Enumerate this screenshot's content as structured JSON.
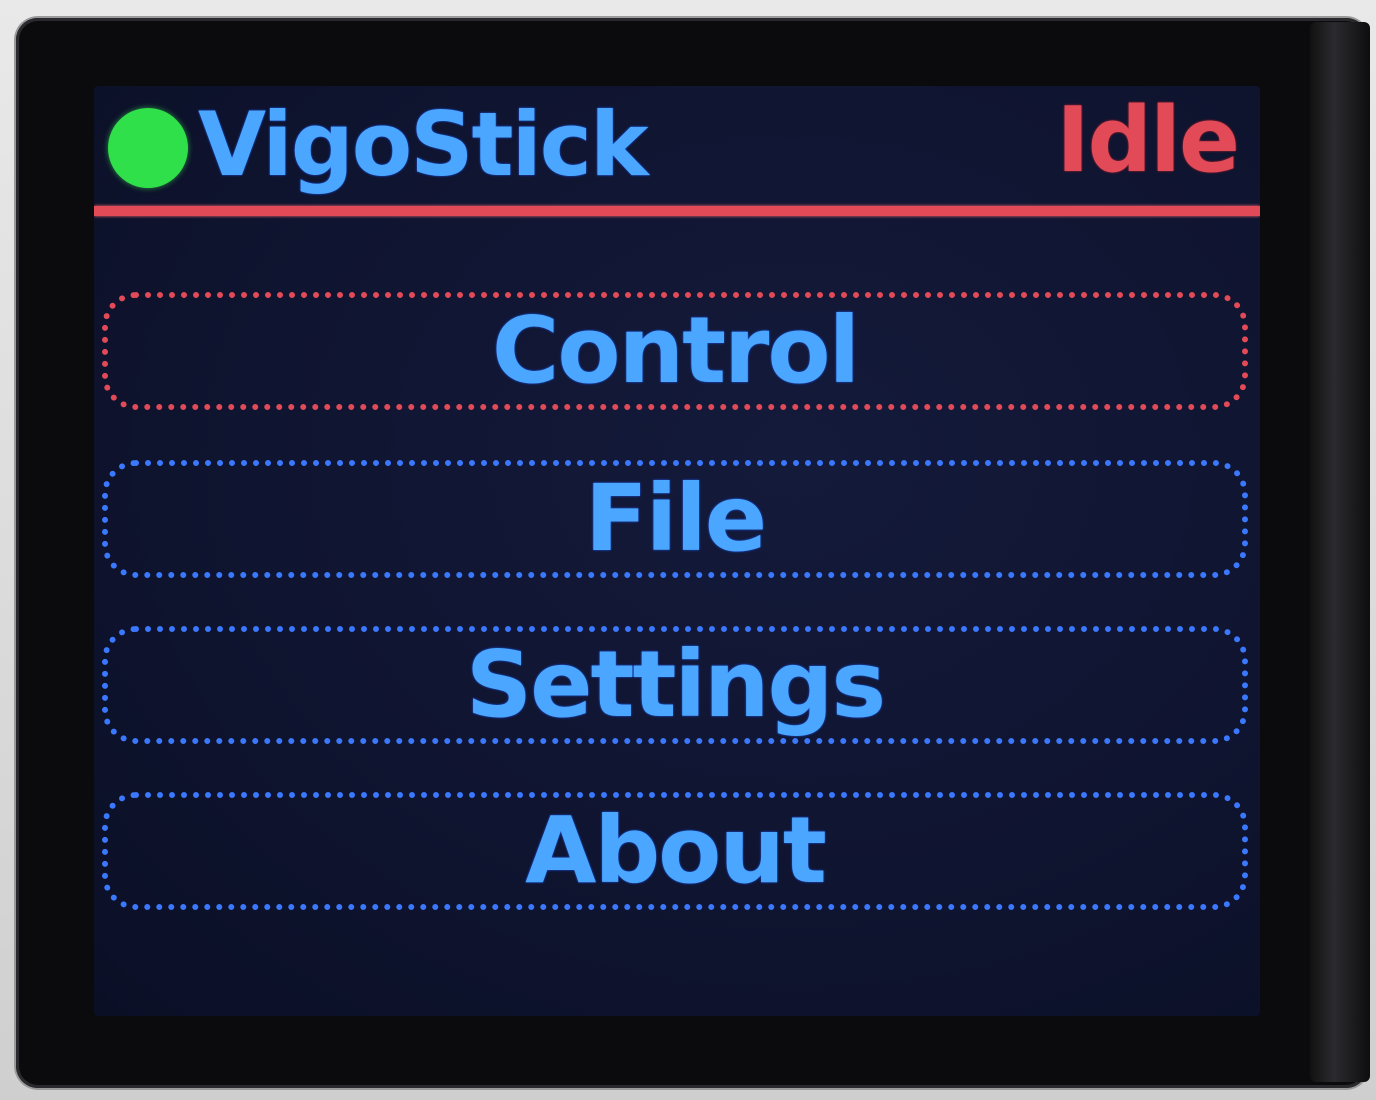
{
  "header": {
    "status_indicator": "green-dot-icon",
    "title": "VigoStick",
    "state": "Idle"
  },
  "menu": {
    "selected_index": 0,
    "items": [
      {
        "label": "Control"
      },
      {
        "label": "File"
      },
      {
        "label": "Settings"
      },
      {
        "label": "About"
      }
    ]
  },
  "colors": {
    "background": "#0f1430",
    "text": "#4aa6ff",
    "accent_red": "#e24a58",
    "border_blue": "#3a78ff",
    "status_green": "#2fe04a"
  }
}
